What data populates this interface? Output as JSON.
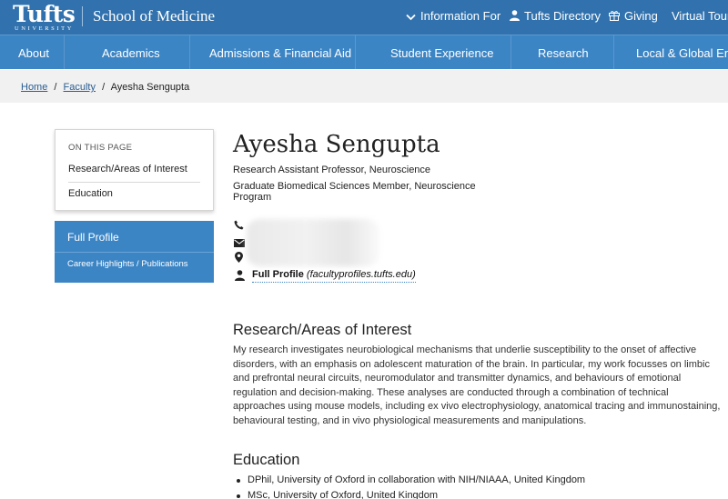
{
  "header": {
    "logo_text": "Tufts",
    "logo_subtext": "UNIVERSITY",
    "school_name": "School of Medicine",
    "utility_links": [
      "Information For",
      "Tufts Directory",
      "Giving",
      "Virtual Tour"
    ]
  },
  "main_nav": {
    "items": [
      "About",
      "Academics",
      "Admissions & Financial Aid",
      "Student Experience",
      "Research",
      "Local & Global Enga"
    ]
  },
  "breadcrumb": {
    "home": "Home",
    "separator": "/",
    "faculty": "Faculty",
    "current": "Ayesha Sengupta"
  },
  "sidebar": {
    "on_this_page": "ON THIS PAGE",
    "links": [
      "Research/Areas of Interest",
      "Education"
    ],
    "full_profile": "Full Profile",
    "career_link": "Career Highlights / Publications"
  },
  "profile": {
    "name": "Ayesha Sengupta",
    "title_primary": "Research Assistant Professor, Neuroscience",
    "title_secondary": "Graduate Biomedical Sciences Member, Neuroscience Program",
    "full_profile_label": "Full Profile",
    "full_profile_url": "(facultyprofiles.tufts.edu)"
  },
  "research": {
    "heading": "Research/Areas of Interest",
    "text": "My research investigates neurobiological mechanisms that underlie susceptibility to the onset of affective disorders, with an emphasis on adolescent maturation of the brain. In particular, my work focusses on limbic and prefrontal neural circuits, neuromodulator and transmitter dynamics, and behaviours of emotional regulation and decision-making. These analyses are conducted through a combination of technical approaches using mouse models, including ex vivo electrophysiology, anatomical tracing and immunostaining, behavioural testing, and in vivo physiological measurements and manipulations."
  },
  "education": {
    "heading": "Education",
    "items": [
      "DPhil, University of Oxford in collaboration with NIH/NIAAA, United Kingdom",
      "MSc, University of Oxford, United Kingdom"
    ]
  },
  "colors": {
    "top_bar": "#3172ae",
    "nav_bar": "#3c85c5",
    "breadcrumb_bg": "#f1f1f1",
    "link": "#2a5d92"
  },
  "icons": [
    "chevron-down-icon",
    "person-icon",
    "gift-icon",
    "phone-icon",
    "envelope-icon",
    "location-pin-icon",
    "user-icon"
  ]
}
